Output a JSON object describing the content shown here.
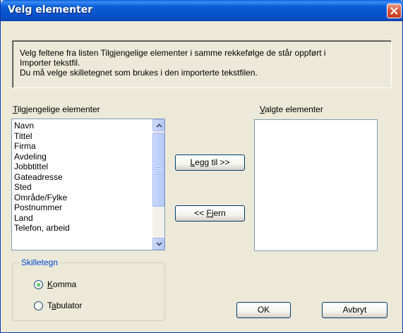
{
  "window": {
    "title": "Velg elementer"
  },
  "info": {
    "line1": "Velg feltene fra listen Tilgjengelige elementer i samme rekkefølge de står oppført i",
    "line2": "Importer tekstfil.",
    "line3": "Du må velge skilletegnet som brukes i den importerte tekstfilen."
  },
  "available": {
    "label_mnemonic": "T",
    "label_rest": "ilgjengelige elementer",
    "items": [
      "Navn",
      "Tittel",
      "Firma",
      "Avdeling",
      "Jobbtittel",
      "Gateadresse",
      "Sted",
      "Område/Fylke",
      "Postnummer",
      "Land",
      "Telefon, arbeid"
    ]
  },
  "selected": {
    "label_mnemonic": "V",
    "label_rest": "algte elementer",
    "items": []
  },
  "buttons": {
    "add": {
      "mnemonic": "L",
      "rest": "egg til >>"
    },
    "remove": {
      "prefix": "<< ",
      "mnemonic": "F",
      "rest": "jern"
    },
    "ok": "OK",
    "cancel": "Avbryt"
  },
  "separator": {
    "title": "Skilletegn",
    "options": [
      {
        "mnemonic": "K",
        "rest": "omma",
        "selected": true
      },
      {
        "prefix": "T",
        "mnemonic": "a",
        "rest": "bulator",
        "selected": false
      }
    ]
  },
  "icons": {
    "close": "close-icon",
    "scroll_up": "chevron-up-icon",
    "scroll_down": "chevron-down-icon"
  }
}
